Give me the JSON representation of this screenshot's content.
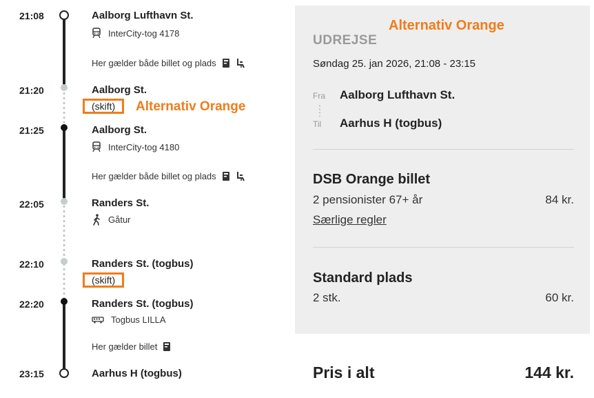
{
  "timeline": {
    "stops": [
      {
        "time": "21:08",
        "station": "Aalborg Lufthavn St."
      },
      {
        "time": "21:20",
        "station": "Aalborg St.",
        "skift": "(skift)"
      },
      {
        "time": "21:25",
        "station": "Aalborg St."
      },
      {
        "time": "22:05",
        "station": "Randers St."
      },
      {
        "time": "22:10",
        "station": "Randers St. (togbus)",
        "skift": "(skift)"
      },
      {
        "time": "22:20",
        "station": "Randers St. (togbus)"
      },
      {
        "time": "23:15",
        "station": "Aarhus H (togbus)"
      }
    ],
    "legs": [
      {
        "mode_icon": "train-icon",
        "label": "InterCity-tog 4178",
        "note": "Her gælder både billet og plads"
      },
      {
        "mode_icon": "train-icon",
        "label": "InterCity-tog 4180",
        "note": "Her gælder både billet og plads"
      },
      {
        "mode_icon": "walk-icon",
        "label": "Gåtur"
      },
      {
        "mode_icon": "bus-icon",
        "label": "Togbus LILLA",
        "note": "Her gælder billet"
      }
    ],
    "alt_label": "Alternativ Orange"
  },
  "summary": {
    "alt_label": "Alternativ Orange",
    "heading": "UDREJSE",
    "date": "Søndag 25. jan 2026, 21:08 - 23:15",
    "from_label": "Fra",
    "from": "Aalborg Lufthavn St.",
    "to_label": "Til",
    "to": "Aarhus H (togbus)",
    "ticket": {
      "title": "DSB Orange billet",
      "desc": "2 pensionister 67+ år",
      "price": "84 kr.",
      "link": "Særlige regler"
    },
    "seat": {
      "title": "Standard plads",
      "qty": "2 stk.",
      "price": "60 kr."
    },
    "total_label": "Pris i alt",
    "total": "144 kr."
  },
  "colors": {
    "accent": "#f07c1a",
    "panel": "#eeeeee",
    "line": "#222222",
    "dot_grey": "#c5cec9"
  }
}
